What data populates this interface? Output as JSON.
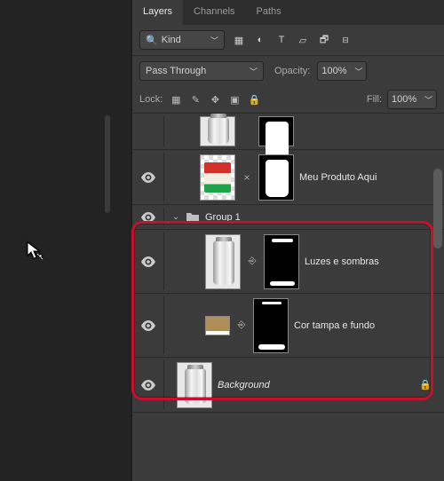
{
  "tabs": {
    "layers": "Layers",
    "channels": "Channels",
    "paths": "Paths"
  },
  "filter": {
    "kind": "Kind"
  },
  "blend": {
    "mode": "Pass Through",
    "opacityLabel": "Opacity:",
    "opacityVal": "100%"
  },
  "lock": {
    "label": "Lock:",
    "fillLabel": "Fill:",
    "fillVal": "100%"
  },
  "layers": {
    "meuProduto": "Meu Produto Aqui",
    "group1": "Group 1",
    "luzes": "Luzes e sombras",
    "corTampa": "Cor tampa e fundo",
    "background": "Background"
  }
}
